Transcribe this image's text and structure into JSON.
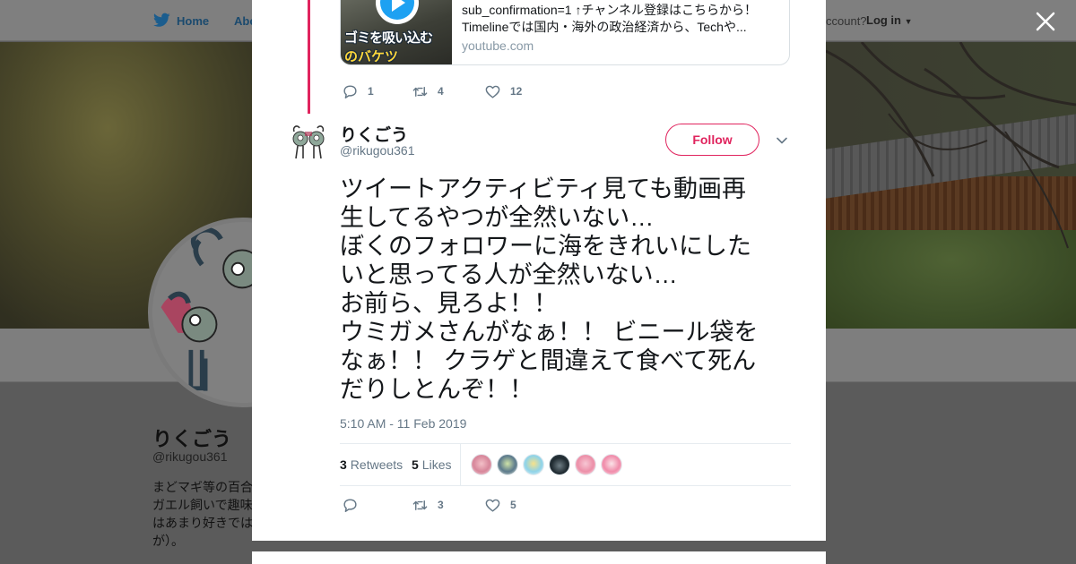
{
  "background": {
    "nav": {
      "home": "Home",
      "about": "Abo",
      "account": "ccount?",
      "login": "Log in"
    },
    "profile": {
      "name": "りくごう",
      "handle": "@rikugou361",
      "bio_lines": [
        "まどマギ等の百合",
        "ガエル飼いで趣味",
        "はあまり好きでは",
        "が）。"
      ]
    }
  },
  "prev_tweet": {
    "card": {
      "thumb_text_1": "ゴミを吸い込む",
      "thumb_text_2": "のバケツ",
      "desc_line_1": "sub_confirmation=1 ↑チャンネル登録はこちらから！",
      "desc_line_2": "Timelineでは国内・海外の政治経済から、Techや...",
      "domain": "youtube.com"
    },
    "replies": "1",
    "retweets": "4",
    "likes": "12"
  },
  "tweet": {
    "name": "りくごう",
    "handle": "@rikugou361",
    "follow_label": "Follow",
    "text_lines": [
      "ツイートアクティビティ見ても動画再",
      "生してるやつが全然いない…",
      "ぼくのフォロワーに海をきれいにした",
      "いと思ってる人が全然いない…",
      "お前ら、見ろよ！！",
      "ウミガメさんがなぁ！！ ビニール袋を",
      "なぁ！！ クラゲと間違えて食べて死ん",
      "だりしとんぞ！！"
    ],
    "timestamp": "5:10 AM - 11 Feb 2019",
    "retweet_count": "3",
    "retweet_label": "Retweets",
    "like_count": "5",
    "like_label": "Likes",
    "action_retweets": "3",
    "action_likes": "5"
  },
  "colors": {
    "accent": "#e0245e",
    "twitter_blue": "#1da1f2",
    "muted": "#657786"
  }
}
